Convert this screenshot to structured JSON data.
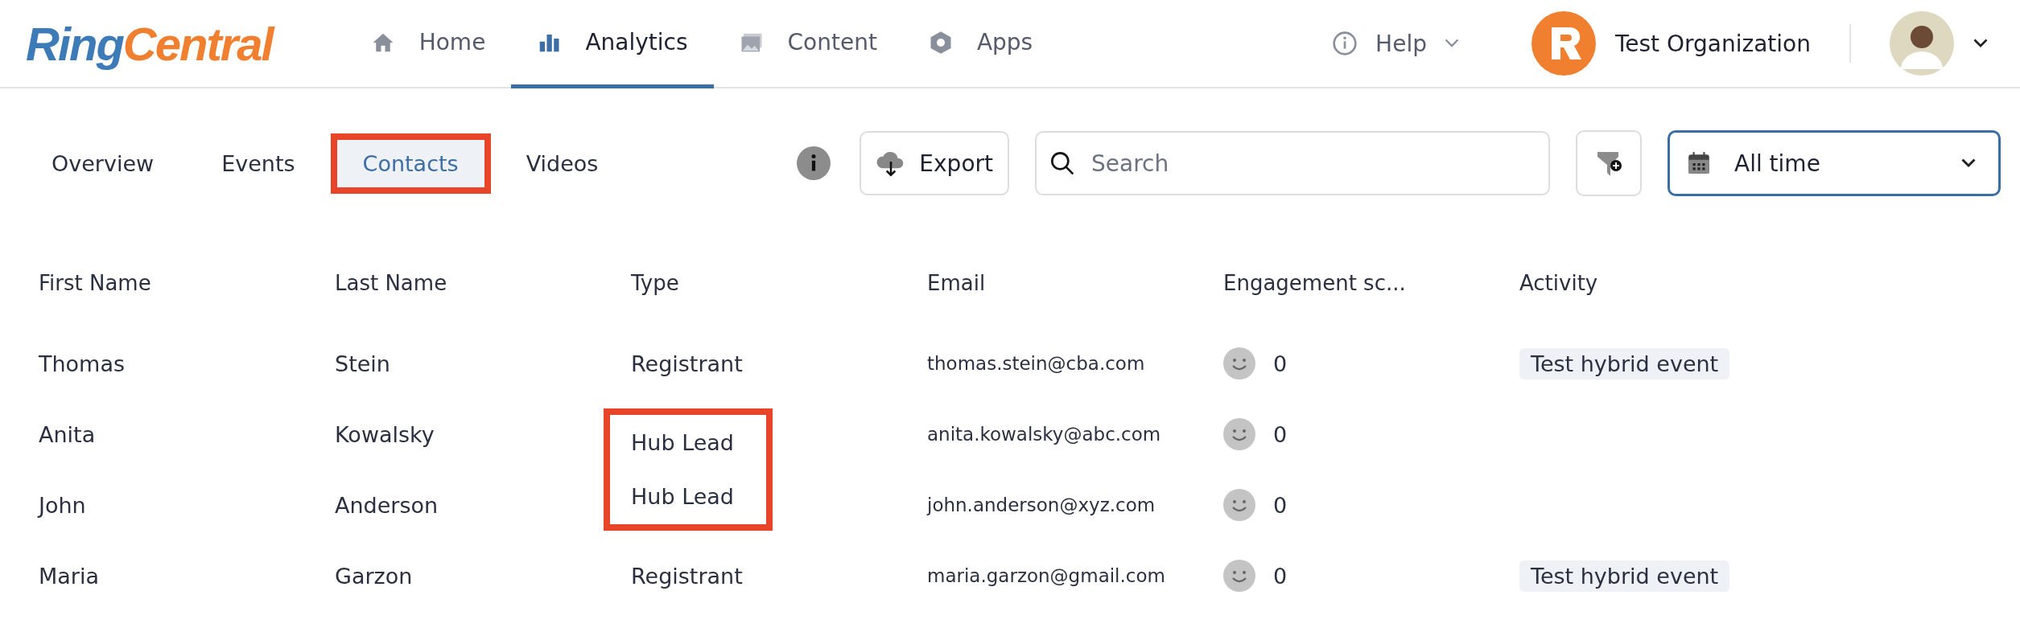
{
  "header": {
    "logo": {
      "part_1": "Ring",
      "part_2": "Central"
    },
    "nav": [
      {
        "label": "Home",
        "selected": false
      },
      {
        "label": "Analytics",
        "selected": true
      },
      {
        "label": "Content",
        "selected": false
      },
      {
        "label": "Apps",
        "selected": false
      }
    ],
    "help": "Help",
    "organization": "Test Organization"
  },
  "tabs": [
    {
      "label": "Overview",
      "selected": false,
      "annotated": false
    },
    {
      "label": "Events",
      "selected": false,
      "annotated": false
    },
    {
      "label": "Contacts",
      "selected": true,
      "annotated": true
    },
    {
      "label": "Videos",
      "selected": false,
      "annotated": false
    }
  ],
  "toolbar": {
    "export": "Export",
    "search": {
      "placeholder": "Search"
    },
    "date_range": "All time"
  },
  "table": {
    "columns": [
      "First Name",
      "Last Name",
      "Type",
      "Email",
      "Engagement sc...",
      "Activity"
    ],
    "rows": [
      {
        "first": "Thomas",
        "last": "Stein",
        "type": "Registrant",
        "type_annotated": false,
        "email": "thomas.stein@cba.com",
        "score": "0",
        "activity": "Test hybrid event"
      },
      {
        "first": "Anita",
        "last": "Kowalsky",
        "type": "Hub Lead",
        "type_annotated": true,
        "email": "anita.kowalsky@abc.com",
        "score": "0"
      },
      {
        "first": "John",
        "last": "Anderson",
        "type": "Hub Lead",
        "type_annotated": true,
        "email": "john.anderson@xyz.com",
        "score": "0"
      },
      {
        "first": "Maria",
        "last": "Garzon",
        "type": "Registrant",
        "type_annotated": false,
        "email": "maria.garzon@gmail.com",
        "score": "0",
        "activity": "Test hybrid event"
      }
    ]
  }
}
